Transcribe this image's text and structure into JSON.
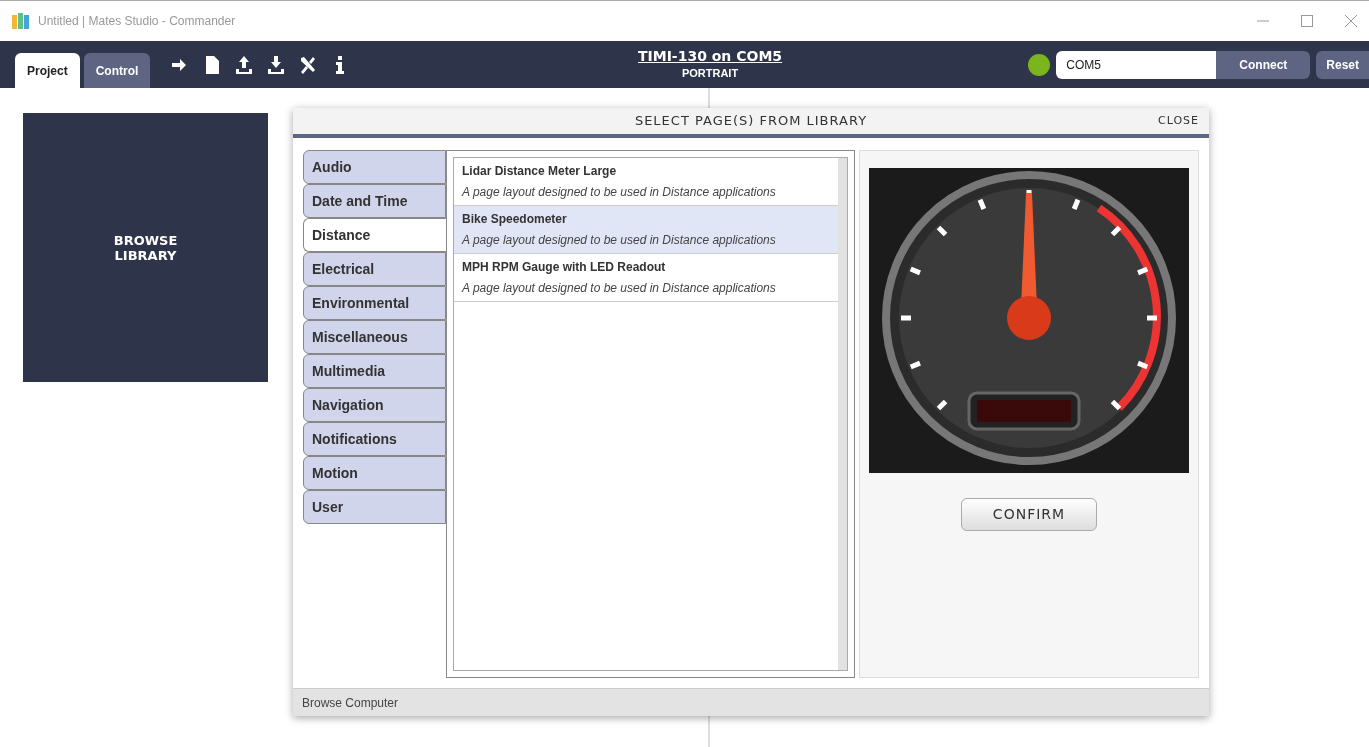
{
  "window": {
    "title": "Untitled | Mates Studio - Commander"
  },
  "tabs": [
    {
      "label": "Project",
      "selected": true
    },
    {
      "label": "Control",
      "selected": false
    }
  ],
  "device": {
    "title": "TIMI-130 on COM5",
    "orientation": "PORTRAIT"
  },
  "connection": {
    "connected": true,
    "port": "COM5",
    "connect_button": "Connect",
    "reset_button": "Reset"
  },
  "browse_library": {
    "label": "BROWSE\nLIBRARY"
  },
  "dialog": {
    "title": "SELECT PAGE(S) FROM LIBRARY",
    "close": "CLOSE",
    "categories": [
      {
        "label": "Audio",
        "selected": false
      },
      {
        "label": "Date and Time",
        "selected": false
      },
      {
        "label": "Distance",
        "selected": true
      },
      {
        "label": "Electrical",
        "selected": false
      },
      {
        "label": "Environmental",
        "selected": false
      },
      {
        "label": "Miscellaneous",
        "selected": false
      },
      {
        "label": "Multimedia",
        "selected": false
      },
      {
        "label": "Navigation",
        "selected": false
      },
      {
        "label": "Notifications",
        "selected": false
      },
      {
        "label": "Motion",
        "selected": false
      },
      {
        "label": "User",
        "selected": false
      }
    ],
    "pages": [
      {
        "name": "Lidar Distance Meter Large",
        "description": "A page layout designed to be used in Distance applications",
        "selected": false
      },
      {
        "name": "Bike Speedometer",
        "description": "A page layout designed to be used in Distance applications",
        "selected": true
      },
      {
        "name": "MPH RPM Gauge with LED Readout",
        "description": "A page layout designed to be used in Distance applications",
        "selected": false
      }
    ],
    "confirm": "CONFIRM",
    "footer": "Browse Computer"
  }
}
